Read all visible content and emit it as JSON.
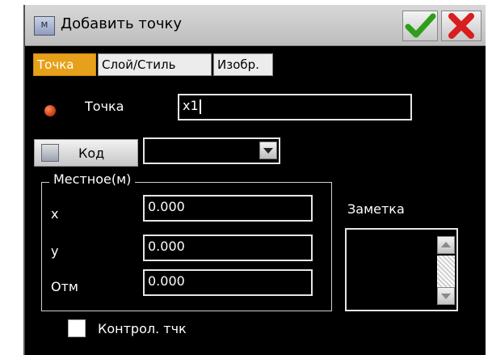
{
  "window": {
    "title": "Добавить точку",
    "app_icon_text": "M"
  },
  "tabs": [
    {
      "label": "Точка",
      "active": true
    },
    {
      "label": "Слой/Стиль",
      "active": false
    },
    {
      "label": "Изобр.",
      "active": false
    }
  ],
  "point": {
    "label": "Точка",
    "value": "x1"
  },
  "code": {
    "button_label": "Код",
    "selected": ""
  },
  "local_group": {
    "title": "Местное(м)",
    "fields": [
      {
        "label": "x",
        "value": "0.000"
      },
      {
        "label": "y",
        "value": "0.000"
      },
      {
        "label": "Отм",
        "value": "0.000"
      }
    ]
  },
  "note": {
    "label": "Заметка",
    "value": ""
  },
  "control_point": {
    "label": "Контрол. тчк",
    "checked": false
  },
  "colors": {
    "active_tab": "#e7a019",
    "ok_check": "#2e9e1c",
    "close_x": "#d81e1e",
    "point_dot": "#d9480f"
  }
}
